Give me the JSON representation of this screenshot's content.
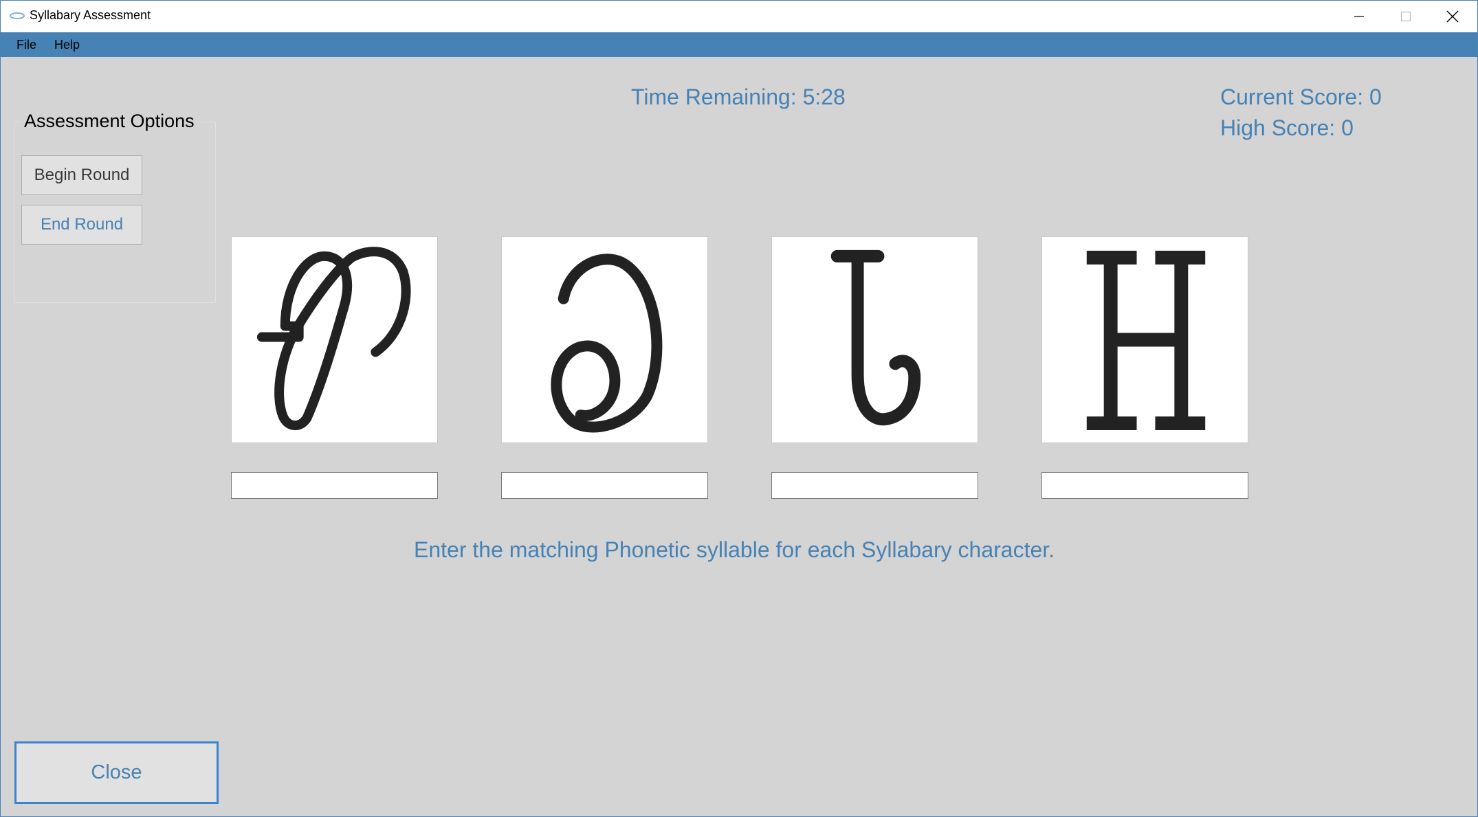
{
  "window": {
    "title": "Syllabary Assessment"
  },
  "menu": {
    "items": [
      "File",
      "Help"
    ]
  },
  "options": {
    "title": "Assessment Options",
    "begin_label": "Begin Round",
    "end_label": "End Round"
  },
  "status": {
    "time_remaining": "Time Remaining: 5:28",
    "current_score": "Current Score: 0",
    "high_score": "High Score: 0"
  },
  "characters": [
    {
      "icon": "cherokee-syllabary-glyph-1"
    },
    {
      "icon": "cherokee-syllabary-glyph-2"
    },
    {
      "icon": "cherokee-syllabary-glyph-3"
    },
    {
      "icon": "cherokee-syllabary-glyph-4"
    }
  ],
  "answers": [
    "",
    "",
    "",
    ""
  ],
  "instruction": "Enter the matching Phonetic syllable for each Syllabary character.",
  "close_label": "Close",
  "colors": {
    "accent": "#4682b4",
    "focus_border": "#3b84d0",
    "background": "#d4d4d4"
  }
}
